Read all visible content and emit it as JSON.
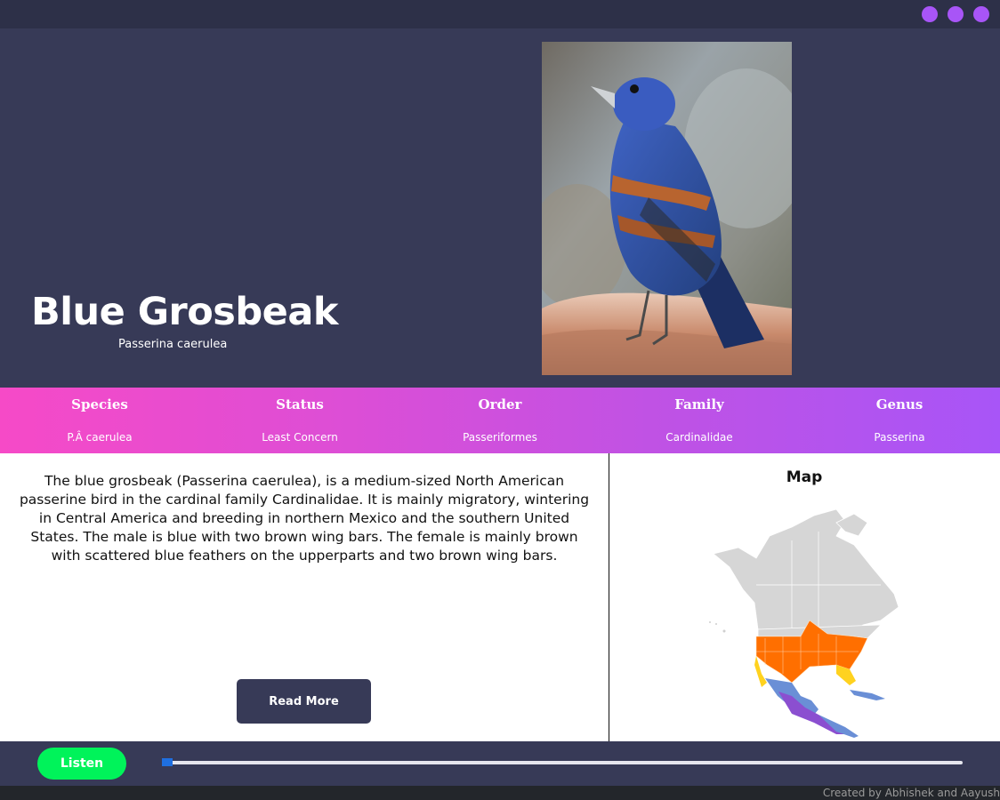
{
  "window": {
    "controls": [
      "minimize",
      "maximize",
      "close"
    ],
    "accent_color": "#a855f7"
  },
  "hero": {
    "common_name": "Blue Grosbeak",
    "scientific_name": "Passerina caerulea",
    "background_color": "#373a57"
  },
  "taxonomy": {
    "items": [
      {
        "label": "Species",
        "value": "P.Â caerulea"
      },
      {
        "label": "Status",
        "value": "Least Concern"
      },
      {
        "label": "Order",
        "value": "Passeriformes"
      },
      {
        "label": "Family",
        "value": "Cardinalidae"
      },
      {
        "label": "Genus",
        "value": "Passerina"
      }
    ],
    "gradient": [
      "#f64ac7",
      "#a855f7"
    ]
  },
  "description": {
    "text": "The blue grosbeak (Passerina caerulea), is a medium-sized North American passerine bird in the cardinal family Cardinalidae. It is mainly migratory, wintering in Central America and breeding in northern Mexico and the southern United States. The male is blue with two brown wing bars. The female is mainly brown with scattered blue feathers on the upperparts and two brown wing bars.",
    "read_more_label": "Read More"
  },
  "map": {
    "title": "Map",
    "range_colors": {
      "breeding": "#ff6f00",
      "migration": "#ffd21f",
      "resident": "#6a8fd6",
      "wintering": "#8b4fd0",
      "other": "#d6d6d6"
    }
  },
  "player": {
    "listen_label": "Listen",
    "listen_color": "#00f35a",
    "progress": 0.0
  },
  "footer": {
    "credit": "Created by Abhishek and Aayush"
  }
}
